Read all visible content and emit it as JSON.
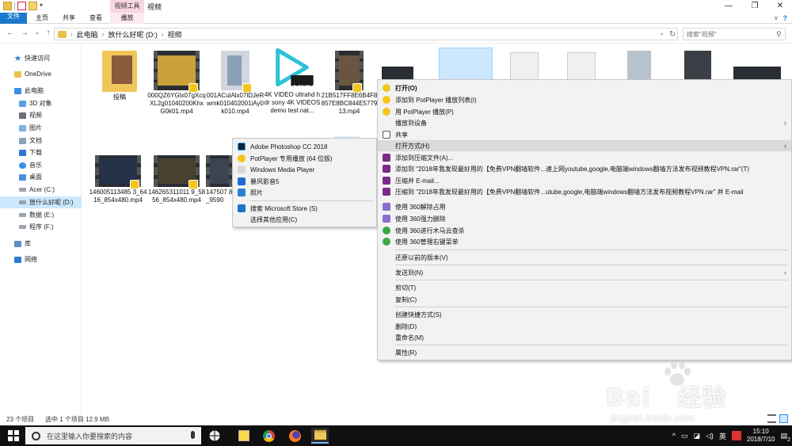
{
  "window": {
    "title": "视频",
    "contextual_tab_group": "视频工具",
    "controls": [
      "—",
      "❐",
      "✕"
    ]
  },
  "ribbon": {
    "tabs": [
      "文件",
      "主页",
      "共享",
      "查看",
      "播放"
    ],
    "expand": "˅",
    "help": "?"
  },
  "address": {
    "breadcrumb": [
      "此电脑",
      "放什么好呢 (D:)",
      "视频"
    ],
    "search_placeholder": "搜索\"视频\""
  },
  "nav_pane": {
    "items": [
      {
        "label": "快速访问",
        "icon": "star-icon"
      },
      {
        "label": "OneDrive",
        "icon": "cloud-icon"
      },
      {
        "label": "此电脑",
        "icon": "computer-icon"
      },
      {
        "label": "3D 对象",
        "icon": "3d-objects-icon"
      },
      {
        "label": "视频",
        "icon": "video-folder-icon"
      },
      {
        "label": "图片",
        "icon": "pictures-folder-icon"
      },
      {
        "label": "文档",
        "icon": "documents-folder-icon"
      },
      {
        "label": "下载",
        "icon": "downloads-folder-icon"
      },
      {
        "label": "音乐",
        "icon": "music-folder-icon"
      },
      {
        "label": "桌面",
        "icon": "desktop-folder-icon"
      },
      {
        "label": "Acer (C:)",
        "icon": "drive-icon"
      },
      {
        "label": "放什么好呢 (D:)",
        "icon": "drive-icon"
      },
      {
        "label": "数据 (E:)",
        "icon": "drive-icon"
      },
      {
        "label": "程序 (F:)",
        "icon": "drive-icon"
      },
      {
        "label": "库",
        "icon": "library-icon"
      },
      {
        "label": "网络",
        "icon": "network-icon"
      }
    ]
  },
  "files": [
    {
      "name": "投稿",
      "kind": "folder"
    },
    {
      "name": "000QZ6YGlx07gXcqXL2g01040200KhxG0k01.mp4",
      "kind": "video"
    },
    {
      "name": "001ACulAlx07lDJeRwmk010402001iAy0k010.mp4",
      "kind": "video"
    },
    {
      "name": "4K VIDEO ultrahd hdr sony 4K VIDEOS demo test nat...",
      "kind": "mkv",
      "badge": "MKV"
    },
    {
      "name": "21B517FF8E6B4F8857E8BC844E577913.mp4",
      "kind": "video"
    },
    {
      "name": "146005113485 3_6416_854x480.mp4",
      "kind": "video"
    },
    {
      "name": "146265311011 9_5856_854x480.mp4",
      "kind": "video"
    },
    {
      "name": "147507 8_9590",
      "kind": "video"
    }
  ],
  "status": {
    "count": "23 个项目",
    "selection": "选中 1 个项目  12.9 MB"
  },
  "context_menu": {
    "items": [
      {
        "label": "打开(O)",
        "bold": true,
        "icon": "potplayer-icon"
      },
      {
        "label": "添加到 PotPlayer 播放列表(I)",
        "icon": "potplayer-icon"
      },
      {
        "label": "用 PotPlayer 播放(P)",
        "icon": "potplayer-icon"
      },
      {
        "label": "播放到设备",
        "submenu": true
      },
      {
        "label": "共享",
        "icon": "share-icon"
      },
      {
        "label": "打开方式(H)",
        "submenu": true,
        "highlight": true
      },
      {
        "label": "添加到压缩文件(A)...",
        "icon": "winrar-icon"
      },
      {
        "label": "添加到 \"2018年我发现最好用的【免费VPN翻墙软件...速上网youtube,google,电脑端windows翻墙方法发布视频教程VPN.rar\"(T)",
        "icon": "winrar-icon"
      },
      {
        "label": "压缩并 E-mail...",
        "icon": "winrar-icon"
      },
      {
        "label": "压缩到 \"2018年我发现最好用的【免费VPN翻墙软件...utube,google,电脑端windows翻墙方法发布视频教程VPN.rar\" 并 E-mail",
        "icon": "winrar-icon"
      },
      {
        "label": "使用 360解除占用",
        "icon": "360-unlock-icon"
      },
      {
        "label": "使用 360强力删除",
        "icon": "360-delete-icon"
      },
      {
        "label": "使用 360进行木马云查杀",
        "icon": "360-scan-icon"
      },
      {
        "label": "使用 360管理右键菜单",
        "icon": "360-menu-icon"
      },
      {
        "label": "还原以前的版本(V)"
      },
      {
        "label": "发送到(N)",
        "submenu": true
      },
      {
        "label": "剪切(T)"
      },
      {
        "label": "复制(C)"
      },
      {
        "label": "创建快捷方式(S)"
      },
      {
        "label": "删除(D)"
      },
      {
        "label": "重命名(M)"
      },
      {
        "label": "属性(R)"
      }
    ]
  },
  "open_with_menu": {
    "items": [
      {
        "label": "Adobe Photoshop CC 2018",
        "icon": "photoshop-icon"
      },
      {
        "label": "PotPlayer 专用播放 (64 位版)",
        "icon": "potplayer-icon"
      },
      {
        "label": "Windows Media Player",
        "icon": "media-player-icon"
      },
      {
        "label": "暴风影音5",
        "icon": "baofeng-icon"
      },
      {
        "label": "照片",
        "icon": "photos-icon"
      },
      {
        "label": "搜索 Microsoft Store (S)",
        "icon": "store-icon"
      },
      {
        "label": "选择其他应用(C)"
      }
    ]
  },
  "taskbar": {
    "search_placeholder": "在这里输入你要搜索的内容",
    "apps": [
      "pinwheel-app-icon",
      "sticky-notes-icon",
      "chrome-icon",
      "firefox-icon",
      "file-explorer-icon"
    ],
    "tray": {
      "lang": "英",
      "time": "15:10",
      "date": "2018/7/10",
      "notifications": "2"
    }
  },
  "watermark": {
    "text": "Bai🐾经验",
    "logo_left": "Bai",
    "logo_right": "经验",
    "url": "jingyan.baidu.com"
  },
  "colors": {
    "accent": "#1979ca",
    "selection": "#cce8ff",
    "context_tab": "#f7d6e0",
    "taskbar": "#101010",
    "potplayer": "#f4c61a"
  }
}
